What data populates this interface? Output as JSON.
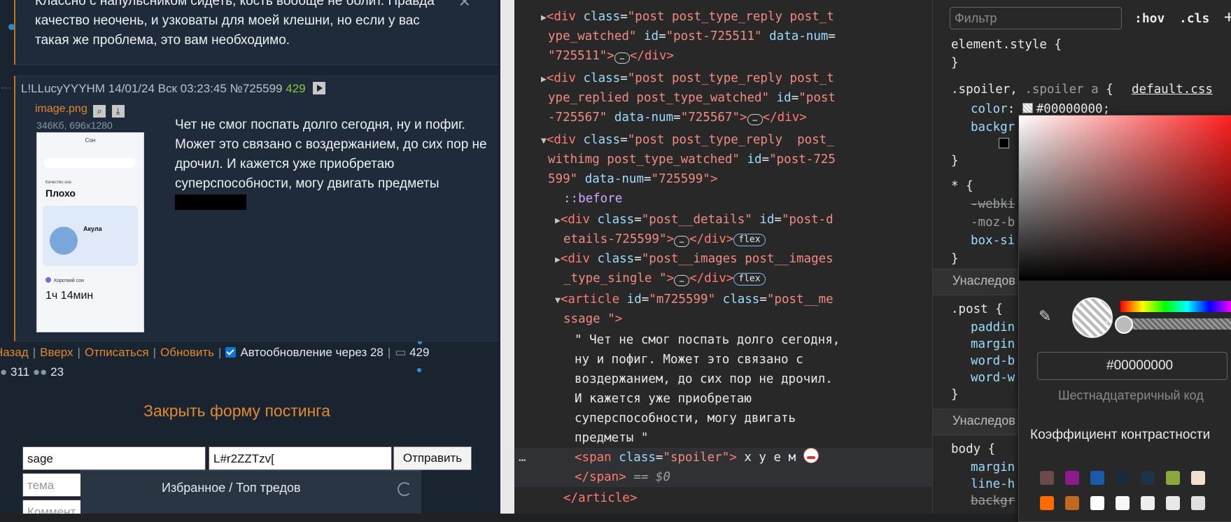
{
  "forum": {
    "prev_post_text": "Классно с напульсником сидеть, кость вообще не болит. Правда качество неочень, и узковаты для моей клешни, но если у вас такая же проблема, это вам необходимо.",
    "post": {
      "author": "L!LLucyYYYHM",
      "date": "14/01/24 Вск 03:23:45",
      "num": "№725599",
      "replies": "429",
      "image_name": "image.png",
      "image_meta": "346Кб, 696x1280",
      "thumb": {
        "header": "Сон",
        "quality_label": "Качество сна",
        "quality_value": "Плохо",
        "animal": "Акула",
        "short_sleep": "Короткий сон",
        "duration": "1ч 14мин"
      },
      "message": "Чет не смог поспать долго сегодня, ну и пофиг. Может это связано с воздержанием, до сих пор не дрочил. И кажется уже приобретаю суперспособности, могу двигать предметы"
    },
    "nav": {
      "back": "Назад",
      "up": "Вверх",
      "unsubscribe": "Отписаться",
      "refresh": "Обновить",
      "autoupdate": "Автообновление через 28",
      "count": "429"
    },
    "stats": {
      "posters": "311",
      "users": "23"
    },
    "close_form": "Закрыть форму постинга",
    "form": {
      "email": "sage",
      "password": "L#r2ZZTzv[",
      "submit": "Отправить",
      "subject_placeholder": "тема",
      "comment_placeholder": "Коммент"
    },
    "favorites": "Избранное / Топ тредов"
  },
  "dom": {
    "lines": [
      "\"725511\">",
      "\"725567\" data-num=\"725567\">",
      "599\" data-num=\"725599\">"
    ],
    "text_node": [
      "\" Чет не смог поспать долго сегодня,",
      "ну и пофиг. Может это связано с",
      "воздержанием, до сих пор не дрочил.",
      "И кажется уже приобретаю",
      "суперспособности, могу двигать",
      "предметы \""
    ],
    "spoiler_text": " х у е м ",
    "eq": "== $0",
    "badge_flex": "flex"
  },
  "styles": {
    "filter_placeholder": "Фильтр",
    "hov": ":hov",
    "cls": ".cls",
    "element_style": "element.style {",
    "source": "default.css",
    "color_value": "#00000000;",
    "inherited_1": "Унаследов",
    "inherited_2": "Унаследов",
    "post_rule": ".post {",
    "body_rule": "body {",
    "picker": {
      "hex": "#00000000",
      "hex_label": "Шестнадцатеричный код",
      "contrast": "Коэффициент контрастности",
      "swatches": [
        "#6d4a4a",
        "#8b1a8b",
        "#1a5aa8",
        "#1a2a3a",
        "#1f3347",
        "#8ca83a",
        "#f0e0d0",
        "#ff6a00",
        "#c06a20",
        "#ffffff",
        "#f7f7f7",
        "#eeeeee",
        "#e8e8e8",
        "#e0e0e0"
      ]
    }
  }
}
